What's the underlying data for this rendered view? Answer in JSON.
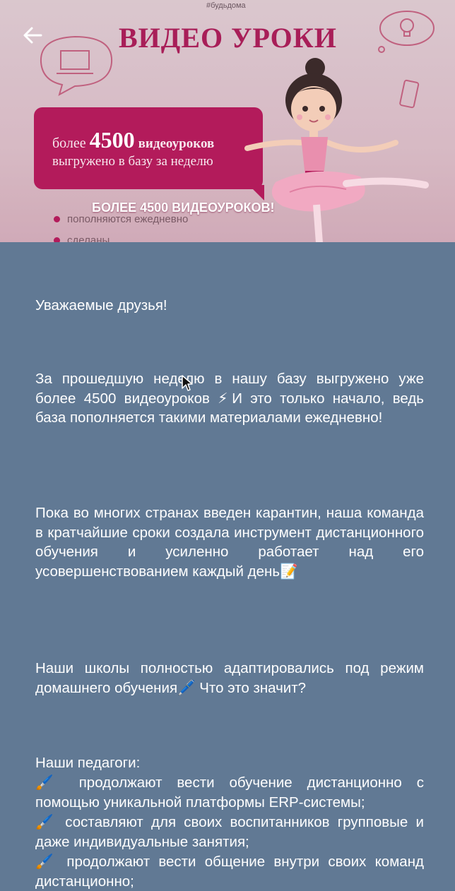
{
  "banner": {
    "hashtag": "#будьдома",
    "title": "ВИДЕО УРОКИ",
    "promo_prefix": "более",
    "promo_number": "4500",
    "promo_word": "видеоуроков",
    "promo_line2": "выгружено в базу за неделю",
    "subtitle": "БОЛЕЕ 4500 ВИДЕОУРОКОВ!",
    "bullets": [
      "пополняются ежедневно",
      "сделаны"
    ]
  },
  "article": {
    "greeting": "Уважаемые друзья!",
    "para1": "За прошедшую неделю в нашу базу выгружено уже более 4500 видеоуроков ⚡И это только начало, ведь база пополняется такими материалами ежедневно!",
    "para2": "Пока во многих странах введен карантин, наша команда в кратчайшие сроки создала инструмент дистанционного обучения и усиленно работает над его усовершенствованием каждый день📝",
    "para3": "Наши школы полностью адаптировались под режим домашнего обучения🖊️ Что это значит?",
    "teachers_intro": "Наши педагоги:",
    "items": [
      "🖌️ продолжают вести обучение дистанционно с помощью уникальной платформы ERP-системы;",
      "🖌️ составляют для своих воспитанников групповые и даже индивидуальные занятия;",
      "🖌️ продолжают вести общение внутри своих команд дистанционно;"
    ]
  },
  "colors": {
    "background": "#617994",
    "accent": "#b31b5b",
    "banner_bg": "#e3c4cf",
    "text": "#ffffff"
  },
  "icons": [
    "back-arrow-icon",
    "mouse-cursor-icon",
    "laptop-icon",
    "lightbulb-icon",
    "phone-icon"
  ]
}
